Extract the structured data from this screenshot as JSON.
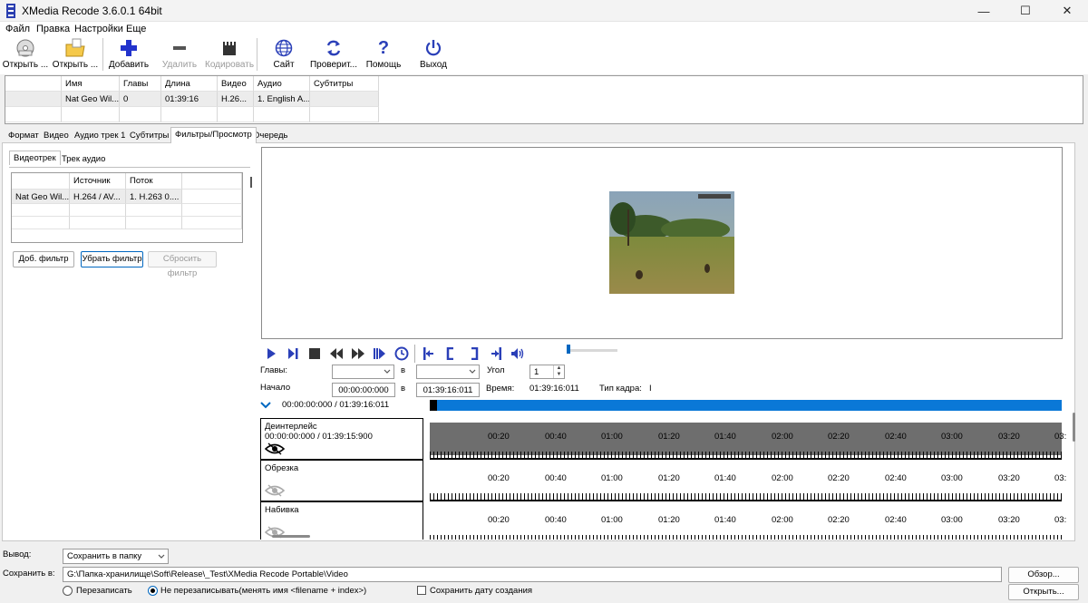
{
  "window": {
    "title": "XMedia Recode 3.6.0.1 64bit",
    "minimize": "—",
    "maximize": "☐",
    "close": "✕"
  },
  "menu": [
    "Файл",
    "Правка",
    "Настройки",
    "Еще"
  ],
  "toolbar": {
    "open_file": "Открыть ...",
    "open_disc": "Открыть ...",
    "add": "Добавить",
    "remove": "Удалить",
    "encode": "Кодировать",
    "site": "Сайт",
    "check": "Проверит...",
    "help": "Помощь",
    "exit": "Выход"
  },
  "filelist": {
    "headers": [
      "Имя",
      "Главы",
      "Длина",
      "Видео",
      "Аудио",
      "Субтитры"
    ],
    "row": [
      "Nat Geo Wil...",
      "0",
      "01:39:16",
      "H.26...",
      "1. English A...",
      ""
    ]
  },
  "tabs": [
    "Формат",
    "Видео",
    "Аудио трек 1",
    "Субтитры",
    "Фильтры/Просмотр",
    "Очередь"
  ],
  "subtabs": [
    "Видеотрек",
    "Трек аудио"
  ],
  "streamlist": {
    "headers": [
      "",
      "Источник",
      "Поток"
    ],
    "row": [
      "Nat Geo Wil...",
      "H.264 / AV...",
      "1. H.263 0...."
    ]
  },
  "filter_buttons": {
    "add": "Доб. фильтр",
    "remove": "Убрать фильтр",
    "reset": "Сбросить фильтр"
  },
  "player": {
    "chapters_label": "Главы:",
    "to_label": "в",
    "angle_label": "Угол",
    "angle_value": "1",
    "start_label": "Начало",
    "start_value": "00:00:00:000",
    "end_value": "01:39:16:011",
    "time_label": "Время:",
    "time_value": "01:39:16:011",
    "frame_type_label": "Тип кадра:",
    "frame_type_value": "I",
    "range": "00:00:00:000 / 01:39:16:011"
  },
  "timeline": {
    "rows": [
      {
        "label": "Деинтерлейс",
        "range": "00:00:00:000 / 01:39:15:900"
      },
      {
        "label": "Обрезка",
        "range": ""
      },
      {
        "label": "Набивка",
        "range": ""
      }
    ],
    "times": [
      "00:20",
      "00:40",
      "01:00",
      "01:20",
      "01:40",
      "02:00",
      "02:20",
      "02:40",
      "03:00",
      "03:20",
      "03:"
    ]
  },
  "bottom": {
    "output_label": "Вывод:",
    "output_value": "Сохранить в папку",
    "save_label": "Сохранить в:",
    "save_path": "G:\\Папка-хранилище\\Soft\\Release\\_Test\\XMedia Recode Portable\\Video",
    "browse": "Обзор...",
    "open": "Открыть...",
    "overwrite": "Перезаписать",
    "no_overwrite": "Не перезаписывать(менять имя <filename + index>)",
    "keep_date": "Сохранить дату создания"
  }
}
